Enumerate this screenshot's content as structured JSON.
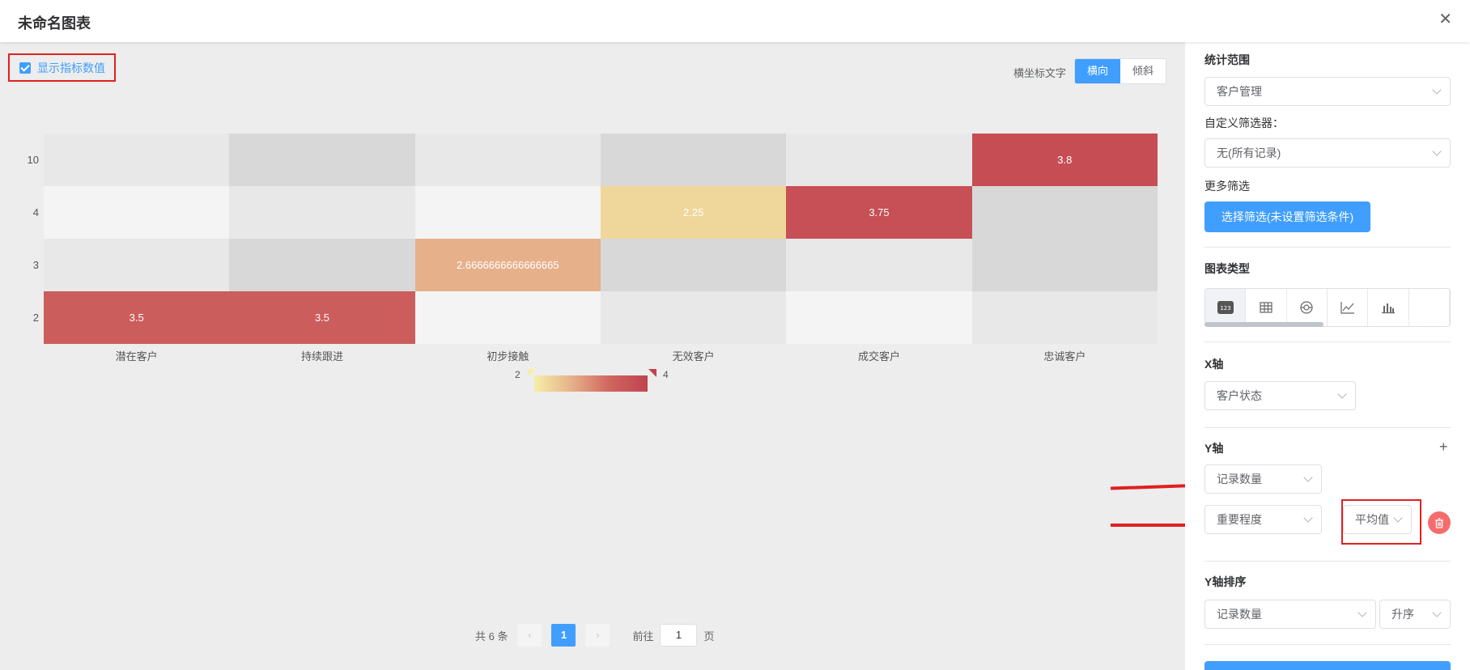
{
  "header": {
    "title": "未命名图表",
    "close_icon": "✕"
  },
  "toolbar": {
    "show_values_label": "显示指标数值",
    "axis_text_label": "横坐标文字",
    "axis_text_options": [
      "横向",
      "倾斜"
    ],
    "axis_text_selected": "横向"
  },
  "chart_data": {
    "type": "heatmap",
    "x": [
      "潜在客户",
      "持续跟进",
      "初步接触",
      "无效客户",
      "成交客户",
      "忠诚客户"
    ],
    "y": [
      "10",
      "4",
      "3",
      "2"
    ],
    "cells": [
      {
        "x": "忠诚客户",
        "y": "10",
        "value": 3.8,
        "label": "3.8"
      },
      {
        "x": "无效客户",
        "y": "4",
        "value": 2.25,
        "label": "2.25"
      },
      {
        "x": "成交客户",
        "y": "4",
        "value": 3.75,
        "label": "3.75"
      },
      {
        "x": "初步接触",
        "y": "3",
        "value": 2.6666666666666665,
        "label": "2.6666666666666665"
      },
      {
        "x": "潜在客户",
        "y": "2",
        "value": 3.5,
        "label": "3.5"
      },
      {
        "x": "持续跟进",
        "y": "2",
        "value": 3.5,
        "label": "3.5"
      }
    ],
    "visual_map": {
      "min": "2",
      "max": "4",
      "colors": [
        "#f5efa7",
        "#e6b08a",
        "#cf6560",
        "#c0434e"
      ]
    },
    "empty_colors": [
      "#e8e8e8",
      "#d8d8d8",
      "#f4f4f4"
    ]
  },
  "pagination": {
    "total_text": "共 6 条",
    "current": "1",
    "goto_label": "前往",
    "goto_value": "1",
    "page_unit": "页"
  },
  "panel": {
    "scope_label": "统计范围",
    "scope_value": "客户管理",
    "custom_filter_label": "自定义筛选器：",
    "custom_filter_value": "无(所有记录)",
    "more_filter_label": "更多筛选",
    "filter_button": "选择筛选(未设置筛选条件)",
    "chart_type_label": "图表类型",
    "chart_types": [
      "number-icon",
      "table-icon",
      "pie-icon",
      "line-icon",
      "bar-icon"
    ],
    "x_axis_label": "X轴",
    "x_axis_value": "客户状态",
    "y_axis_label": "Y轴",
    "y_axis_1": "记录数量",
    "y_axis_2": "重要程度",
    "y_axis_2_agg": "平均值",
    "y_sort_label": "Y轴排序",
    "y_sort_field": "记录数量",
    "y_sort_order": "升序"
  },
  "colors": {
    "accent": "#409eff",
    "danger": "#f56c6c",
    "highlight": "#e02020"
  }
}
